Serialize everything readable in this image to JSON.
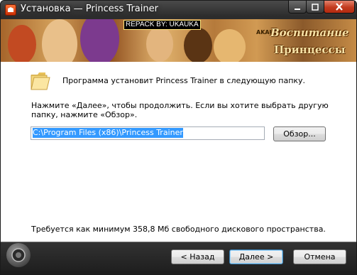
{
  "window": {
    "title": "Установка — Princess Trainer"
  },
  "banner": {
    "repack_text": "REPACK BY: UKAUKA",
    "logo_small": "AKAURUS",
    "logo_title_line1": "Воспитание",
    "logo_title_line2": "Принцессы"
  },
  "content": {
    "install_text": "Программа установит Princess Trainer в следующую папку.",
    "instructions": "Нажмите «Далее», чтобы продолжить. Если вы хотите выбрать другую папку, нажмите «Обзор».",
    "path_value": "C:\\Program Files (x86)\\Princess Trainer",
    "browse_label": "Обзор...",
    "space_required": "Требуется как минимум 358,8 Мб свободного дискового пространства."
  },
  "buttons": {
    "back": "< Назад",
    "next": "Далее >",
    "cancel": "Отмена"
  },
  "icons": {
    "app": "installer-icon",
    "folder": "folder-icon",
    "speaker": "speaker-icon"
  },
  "colors": {
    "title_bar": "#2c2c2c",
    "selection": "#3399ff",
    "close_button": "#c23a1e"
  }
}
